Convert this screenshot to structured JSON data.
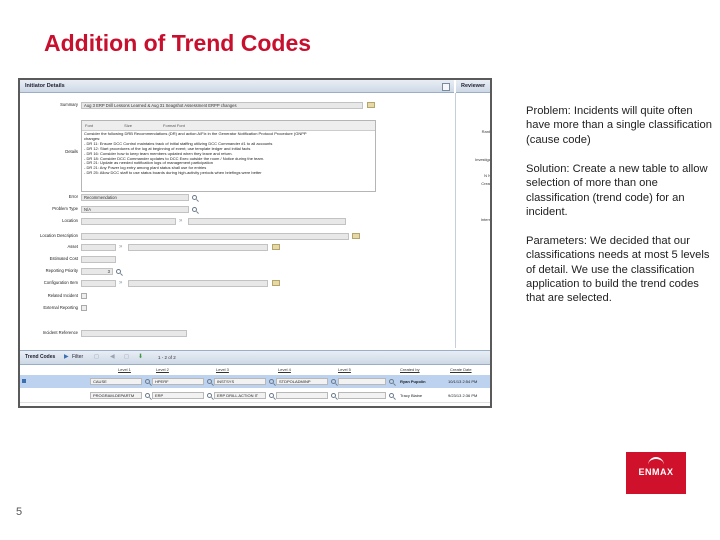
{
  "slide": {
    "title": "Addition of Trend Codes",
    "page_number": "5",
    "logo_text": "ENMAX",
    "paragraphs": [
      "Problem: Incidents will quite often have more than a single classification (cause code)",
      "Solution: Create a new table to allow selection of more than one classification (trend code) for an incident.",
      "Parameters: We decided that our classifications needs at most 5 levels of detail.  We use the classification application to build the trend codes that are selected."
    ]
  },
  "screenshot": {
    "initiator_header": "Initiator Details",
    "reviewer_header": "Reviewer",
    "reviewer_labels": [
      "I",
      "Rank",
      "Investiga",
      "N N",
      "Creat",
      "Intern"
    ],
    "form": {
      "summary_label": "Summary",
      "summary_value": "Aug 3 ERP Drill Lessons Learned & Aug 31 Seagshot Assessment ERPP changes",
      "details_label": "Details",
      "editor_toolbar": [
        "Font",
        "Size",
        "Format Font"
      ],
      "details_lines": [
        "Consider the following DRB Recommendations (DR) and action A/Fix in the Generator Notification Protocol Procedure (GNPP",
        "changes:",
        "- DR 11: Ensure DCC Control maintains track of initial staffing utilizing DCC Commander #1 to all accounts",
        "- DR 12: Start procedures of the log at beginning of event; use template ledger and initial facts",
        "- DR 16: Consider how to keep team members updated when they leave and return.",
        "- DR 18: Consider DCC Commander updates to DCC Exec outside the room / Notice during the team.",
        "- DR 21: Update as needed notification logs of management participation",
        "- DR 21: Any Power log entry among plant status shall use for entries",
        "- DR 25: Allow DCC staff to use status boards during high-activity periods when briefings were better"
      ],
      "error_label": "Error",
      "error_value": "Recommendation",
      "problem_type_label": "Problem Type",
      "problem_type_value": "N/A",
      "location_label": "Location",
      "location_description_label": "Location Description",
      "asset_label": "Asset",
      "estimated_cost_label": "Estimated Cost",
      "reporting_priority_label": "Reporting Priority",
      "reporting_priority_value": "3",
      "configuration_item_label": "Configuration Item",
      "related_label": "Related Incident",
      "external_reporting_label": "External Reporting",
      "incident_reference_label": "Incident Reference"
    },
    "trend_codes": {
      "title": "Trend Codes",
      "filter_label": "Filter",
      "page_info": "1 - 2 of 2",
      "columns": [
        "Level 1",
        "Level 2",
        "Level 3",
        "Level 4",
        "Level 5",
        "Created by",
        "Create Date"
      ],
      "rows": [
        {
          "level1": "CAUSE",
          "level2": "HPERF",
          "level3": "INSTSYS",
          "level4": "STDPOLADMINP",
          "level5": "",
          "created_by": "Ryan Pupolin",
          "create_date": "10/1/13 2:54 PM"
        },
        {
          "level1": "PROGRAM-DEPARTM",
          "level2": "ERP",
          "level3": "ERP DRILL ACTION IT",
          "level4": "",
          "level5": "",
          "created_by": "Tracy Blaine",
          "create_date": "9/23/13 2:36 PM"
        }
      ]
    }
  }
}
